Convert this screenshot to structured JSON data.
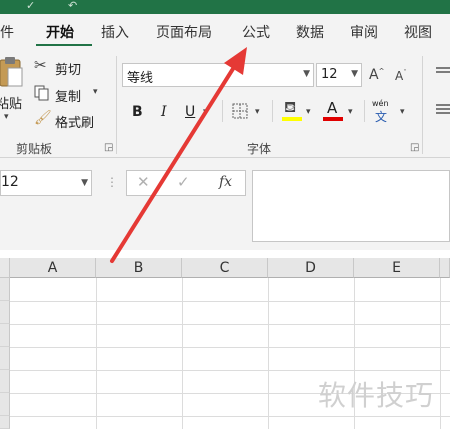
{
  "ribbon_tabs": {
    "file": "文件",
    "home": "开始",
    "insert": "插入",
    "page_layout": "页面布局",
    "formulas": "公式",
    "data": "数据",
    "review": "审阅",
    "view": "视图"
  },
  "clipboard": {
    "paste_label": "粘贴",
    "cut_label": "剪切",
    "copy_label": "复制",
    "format_painter_label": "格式刷",
    "group_label": "剪贴板"
  },
  "font": {
    "font_name": "等线",
    "font_size": "12",
    "bold": "B",
    "italic": "I",
    "underline": "U",
    "phonetic_top": "wén",
    "phonetic_bottom": "文",
    "group_label": "字体",
    "fill_color": "#ffff00",
    "font_color": "#e00000"
  },
  "formula_bar": {
    "name_box_value": "12",
    "fx_label": "fx"
  },
  "grid": {
    "columns": [
      "A",
      "B",
      "C",
      "D",
      "E"
    ]
  },
  "watermark": "软件技巧",
  "accent_color": "#217346",
  "annotation_color": "#e53935"
}
